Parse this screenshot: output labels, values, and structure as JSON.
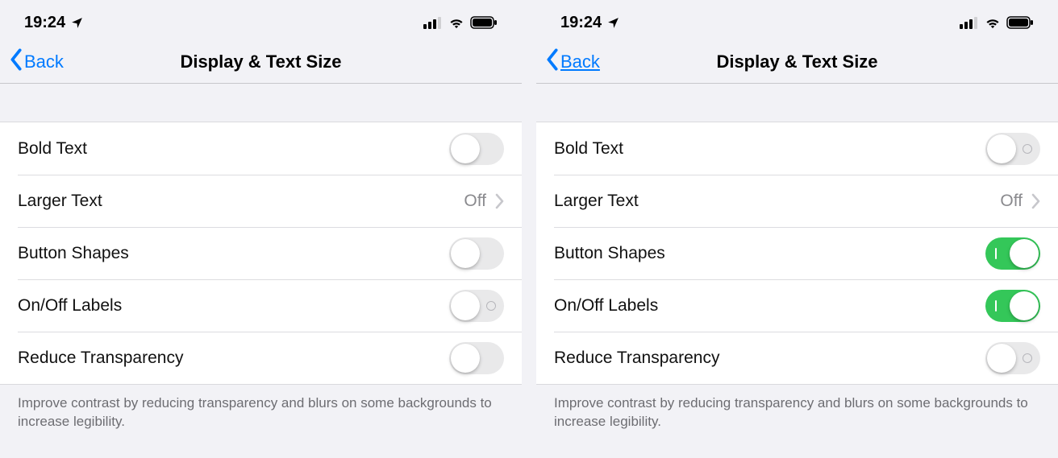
{
  "screens": {
    "left": {
      "status": {
        "time": "19:24"
      },
      "nav": {
        "back": "Back",
        "title": "Display & Text Size",
        "back_underline": false
      },
      "rows": {
        "bold_text": {
          "label": "Bold Text",
          "type": "toggle",
          "on": false,
          "labeled": false
        },
        "larger_text": {
          "label": "Larger Text",
          "type": "link",
          "value": "Off"
        },
        "button_shapes": {
          "label": "Button Shapes",
          "type": "toggle",
          "on": false,
          "labeled": false
        },
        "onoff_labels": {
          "label": "On/Off Labels",
          "type": "toggle",
          "on": false,
          "labeled": true
        },
        "reduce_trans": {
          "label": "Reduce Transparency",
          "type": "toggle",
          "on": false,
          "labeled": false
        }
      },
      "footer": "Improve contrast by reducing transparency and blurs on some backgrounds to increase legibility."
    },
    "right": {
      "status": {
        "time": "19:24"
      },
      "nav": {
        "back": "Back",
        "title": "Display & Text Size",
        "back_underline": true
      },
      "rows": {
        "bold_text": {
          "label": "Bold Text",
          "type": "toggle",
          "on": false,
          "labeled": true
        },
        "larger_text": {
          "label": "Larger Text",
          "type": "link",
          "value": "Off"
        },
        "button_shapes": {
          "label": "Button Shapes",
          "type": "toggle",
          "on": true,
          "labeled": true
        },
        "onoff_labels": {
          "label": "On/Off Labels",
          "type": "toggle",
          "on": true,
          "labeled": true
        },
        "reduce_trans": {
          "label": "Reduce Transparency",
          "type": "toggle",
          "on": false,
          "labeled": true
        }
      },
      "footer": "Improve contrast by reducing transparency and blurs on some backgrounds to increase legibility."
    }
  },
  "colors": {
    "accent": "#007aff",
    "toggle_on": "#34c759"
  }
}
